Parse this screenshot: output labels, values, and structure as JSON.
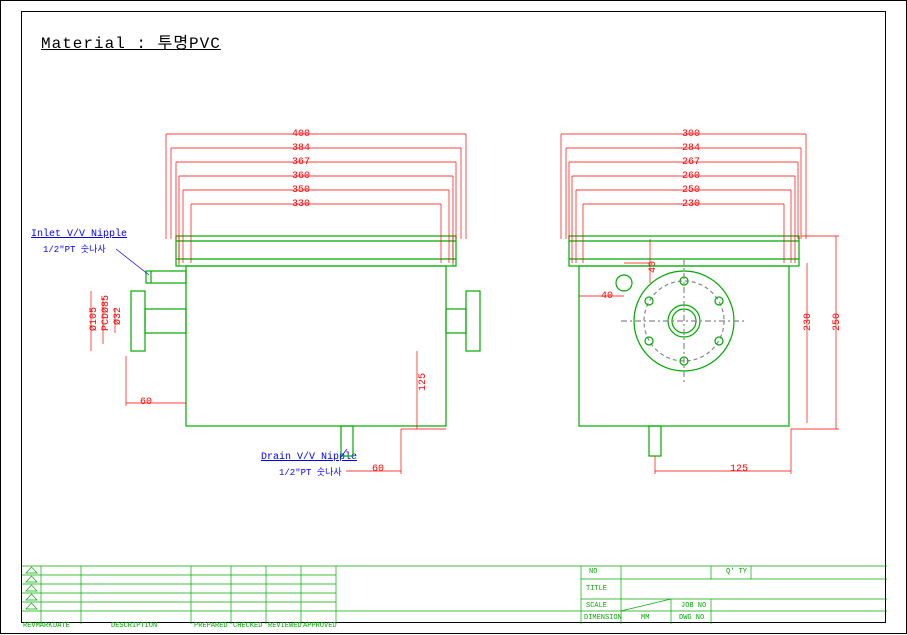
{
  "header": {
    "material_label": "Material : 투명PVC"
  },
  "front_view": {
    "dims_top": [
      "400",
      "384",
      "367",
      "360",
      "350",
      "330"
    ],
    "dim_125": "125",
    "dim_60_left": "60",
    "dim_60_bottom": "60",
    "dia_105": "Ø105",
    "pcd_85": "PCDØ85",
    "dia_32": "Ø32"
  },
  "side_view": {
    "dims_top": [
      "300",
      "284",
      "267",
      "260",
      "250",
      "230"
    ],
    "dim_250": "250",
    "dim_230": "230",
    "dim_125": "125",
    "dim_40a": "40",
    "dim_40b": "40"
  },
  "labels": {
    "inlet": "Inlet V/V Nipple",
    "inlet_sub": "1/2\"PT 숫나사",
    "drain": "Drain V/V Nipple",
    "drain_sub": "1/2\"PT 숫나사"
  },
  "titleblock": {
    "col_revmark": "REVMARK",
    "col_date": "DATE",
    "col_desc": "DESCRIPTION",
    "col_prepared": "PREPARED",
    "col_checked": "CHECKED",
    "col_reviewed": "REVIEWED",
    "col_approved": "APPROVED",
    "no": "NO",
    "title": "TITLE",
    "scale": "SCALE",
    "dimension": "DIMENSION",
    "mm": "MM",
    "job_no": "JOB NO",
    "dwg_no": "DWG NO",
    "qty": "Q' TY"
  }
}
